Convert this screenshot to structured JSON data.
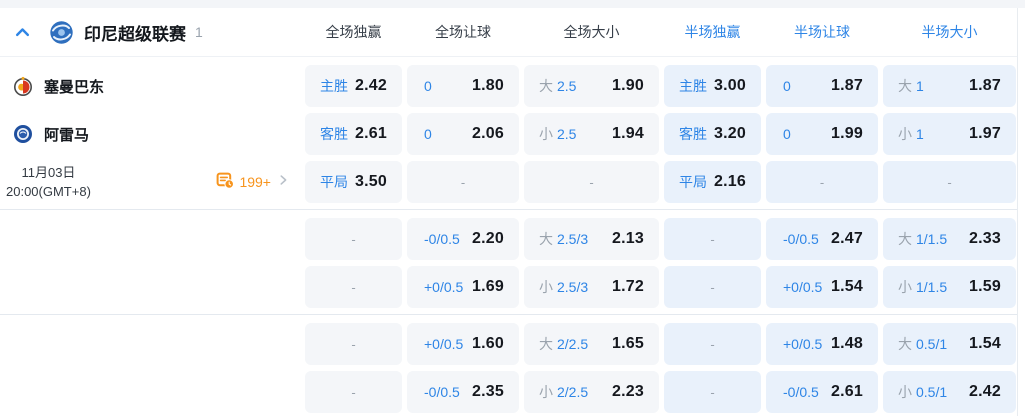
{
  "header": {
    "league_name": "印尼超级联赛",
    "match_count": "1",
    "columns": [
      {
        "label": "全场独赢",
        "scope": "full"
      },
      {
        "label": "全场让球",
        "scope": "full"
      },
      {
        "label": "全场大小",
        "scope": "full"
      },
      {
        "label": "半场独赢",
        "scope": "half"
      },
      {
        "label": "半场让球",
        "scope": "half"
      },
      {
        "label": "半场大小",
        "scope": "half"
      }
    ]
  },
  "match": {
    "home_team": "塞曼巴东",
    "away_team": "阿雷马",
    "date": "11月03日",
    "time": "20:00(GMT+8)",
    "more_markets_count": "199+"
  },
  "icons": {
    "collapse": "chevron-up-icon",
    "league": "league-logo-icon",
    "more_markets": "markets-list-icon",
    "more_arrow": "chevron-right-icon"
  },
  "colors": {
    "accent_blue": "#2e85e6",
    "orange": "#f7941d",
    "full_cell_bg": "#f4f6f9",
    "half_cell_bg": "#e9f1fb",
    "odds_text": "#15181e",
    "muted_gray": "#9aa3ad"
  },
  "empty_placeholder": "-",
  "odds_rows": [
    {
      "cells": [
        {
          "scope": "full",
          "type": "win",
          "label": "主胜",
          "value": "2.42"
        },
        {
          "scope": "full",
          "type": "hdp",
          "label": "0",
          "value": "1.80"
        },
        {
          "scope": "full",
          "type": "ou",
          "side": "大",
          "line": "2.5",
          "value": "1.90"
        },
        {
          "scope": "half",
          "type": "win",
          "label": "主胜",
          "value": "3.00"
        },
        {
          "scope": "half",
          "type": "hdp",
          "label": "0",
          "value": "1.87"
        },
        {
          "scope": "half",
          "type": "ou",
          "side": "大",
          "line": "1",
          "value": "1.87"
        }
      ]
    },
    {
      "cells": [
        {
          "scope": "full",
          "type": "win",
          "label": "客胜",
          "value": "2.61"
        },
        {
          "scope": "full",
          "type": "hdp",
          "label": "0",
          "value": "2.06"
        },
        {
          "scope": "full",
          "type": "ou",
          "side": "小",
          "line": "2.5",
          "value": "1.94"
        },
        {
          "scope": "half",
          "type": "win",
          "label": "客胜",
          "value": "3.20"
        },
        {
          "scope": "half",
          "type": "hdp",
          "label": "0",
          "value": "1.99"
        },
        {
          "scope": "half",
          "type": "ou",
          "side": "小",
          "line": "1",
          "value": "1.97"
        }
      ]
    },
    {
      "cells": [
        {
          "scope": "full",
          "type": "win",
          "label": "平局",
          "value": "3.50"
        },
        {
          "scope": "full",
          "type": "empty"
        },
        {
          "scope": "full",
          "type": "empty"
        },
        {
          "scope": "half",
          "type": "win",
          "label": "平局",
          "value": "2.16"
        },
        {
          "scope": "half",
          "type": "empty"
        },
        {
          "scope": "half",
          "type": "empty"
        }
      ]
    },
    {
      "cells": [
        {
          "scope": "full",
          "type": "empty"
        },
        {
          "scope": "full",
          "type": "hdp",
          "label": "-0/0.5",
          "value": "2.20"
        },
        {
          "scope": "full",
          "type": "ou",
          "side": "大",
          "line": "2.5/3",
          "value": "2.13"
        },
        {
          "scope": "half",
          "type": "empty"
        },
        {
          "scope": "half",
          "type": "hdp",
          "label": "-0/0.5",
          "value": "2.47"
        },
        {
          "scope": "half",
          "type": "ou",
          "side": "大",
          "line": "1/1.5",
          "value": "2.33"
        }
      ]
    },
    {
      "cells": [
        {
          "scope": "full",
          "type": "empty"
        },
        {
          "scope": "full",
          "type": "hdp",
          "label": "+0/0.5",
          "value": "1.69"
        },
        {
          "scope": "full",
          "type": "ou",
          "side": "小",
          "line": "2.5/3",
          "value": "1.72"
        },
        {
          "scope": "half",
          "type": "empty"
        },
        {
          "scope": "half",
          "type": "hdp",
          "label": "+0/0.5",
          "value": "1.54"
        },
        {
          "scope": "half",
          "type": "ou",
          "side": "小",
          "line": "1/1.5",
          "value": "1.59"
        }
      ]
    },
    {
      "cells": [
        {
          "scope": "full",
          "type": "empty"
        },
        {
          "scope": "full",
          "type": "hdp",
          "label": "+0/0.5",
          "value": "1.60"
        },
        {
          "scope": "full",
          "type": "ou",
          "side": "大",
          "line": "2/2.5",
          "value": "1.65"
        },
        {
          "scope": "half",
          "type": "empty"
        },
        {
          "scope": "half",
          "type": "hdp",
          "label": "+0/0.5",
          "value": "1.48"
        },
        {
          "scope": "half",
          "type": "ou",
          "side": "大",
          "line": "0.5/1",
          "value": "1.54"
        }
      ]
    },
    {
      "cells": [
        {
          "scope": "full",
          "type": "empty"
        },
        {
          "scope": "full",
          "type": "hdp",
          "label": "-0/0.5",
          "value": "2.35"
        },
        {
          "scope": "full",
          "type": "ou",
          "side": "小",
          "line": "2/2.5",
          "value": "2.23"
        },
        {
          "scope": "half",
          "type": "empty"
        },
        {
          "scope": "half",
          "type": "hdp",
          "label": "-0/0.5",
          "value": "2.61"
        },
        {
          "scope": "half",
          "type": "ou",
          "side": "小",
          "line": "0.5/1",
          "value": "2.42"
        }
      ]
    }
  ]
}
